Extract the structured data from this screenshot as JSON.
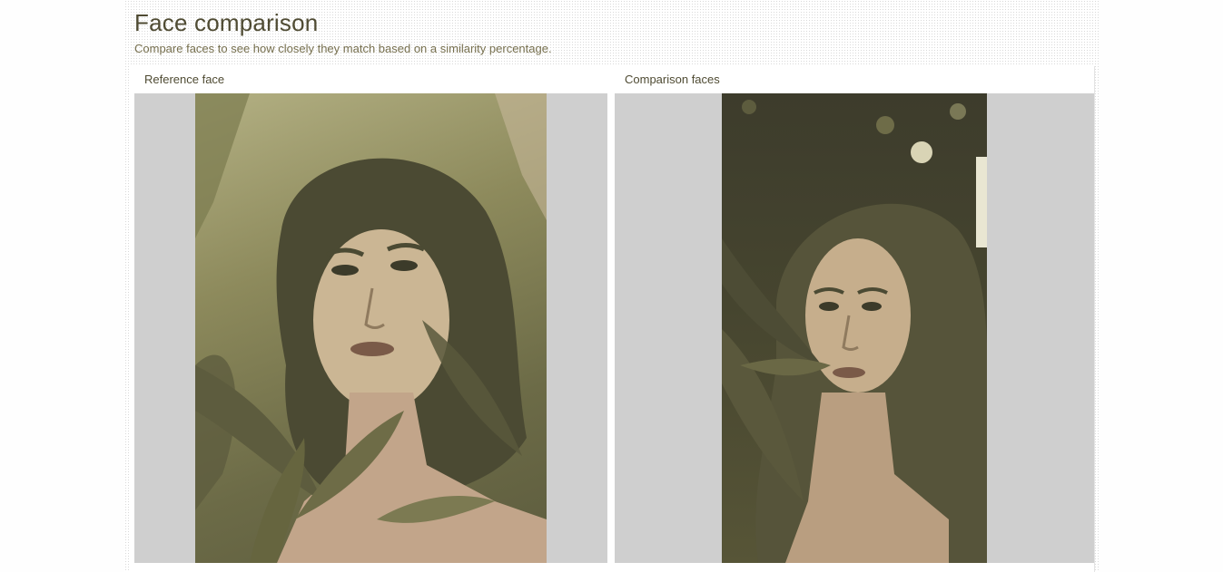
{
  "page": {
    "title": "Face comparison",
    "subtitle": "Compare faces to see how closely they match based on a similarity percentage."
  },
  "panels": {
    "reference": {
      "label": "Reference face"
    },
    "comparison": {
      "label": "Comparison faces"
    }
  },
  "colors": {
    "accent_text": "#4f4b33",
    "subtitle_text": "#77704f",
    "image_frame_bg": "#cfcfcf"
  }
}
